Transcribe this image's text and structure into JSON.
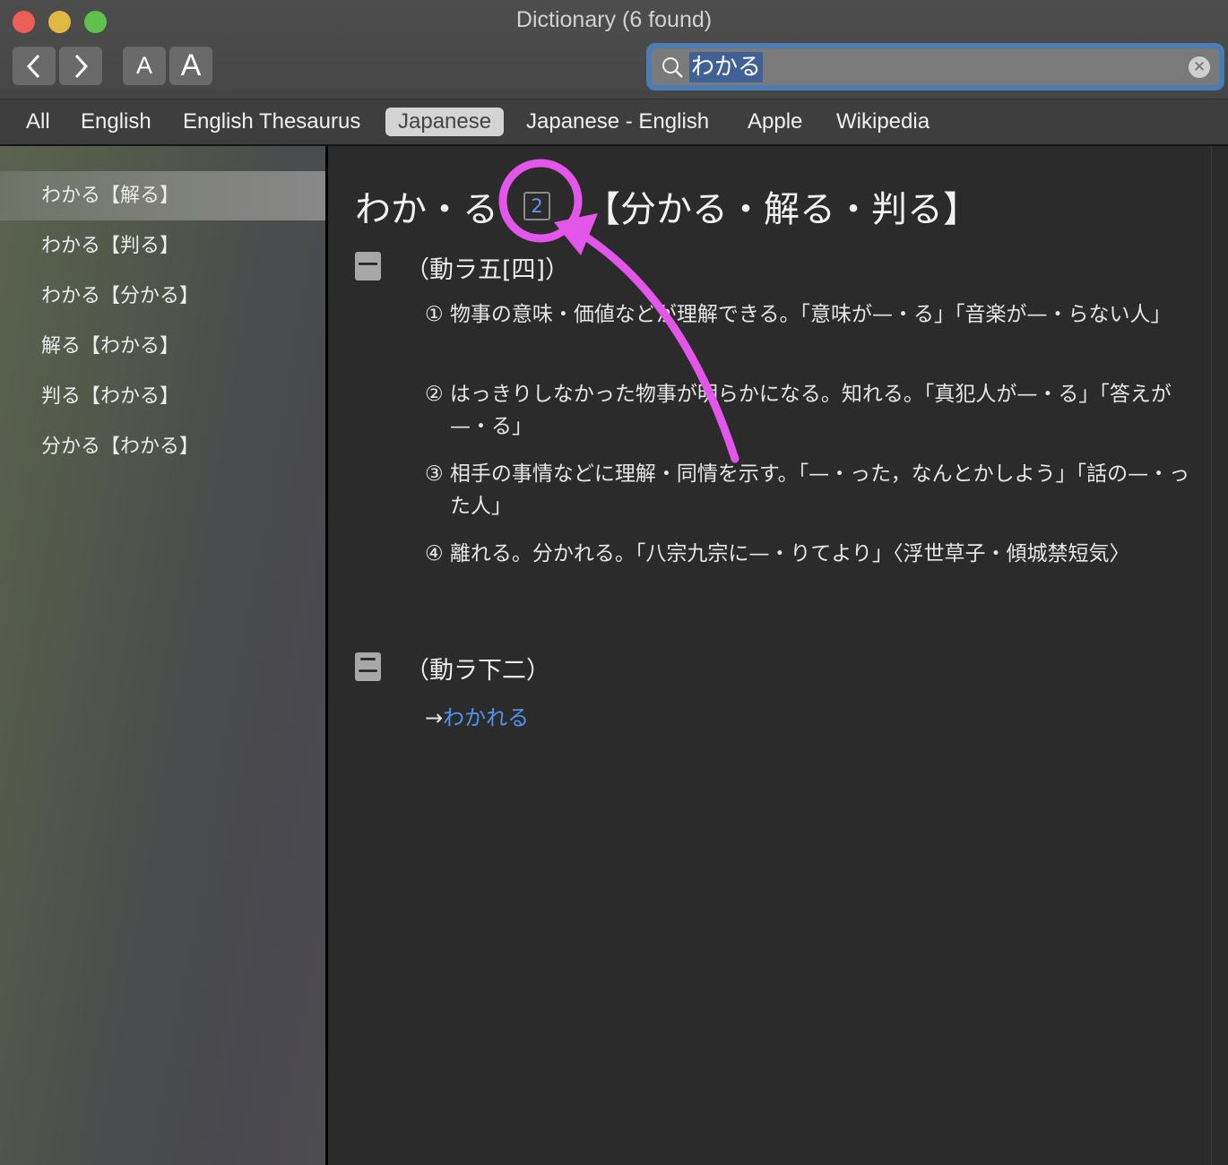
{
  "window": {
    "title": "Dictionary (6 found)"
  },
  "toolbar": {
    "back_icon": "chevron-left-icon",
    "forward_icon": "chevron-right-icon",
    "font_smaller_label": "A",
    "font_bigger_label": "A",
    "search": {
      "value": "わかる",
      "icon": "magnifying-glass-icon",
      "clear_icon": "clear-x-icon"
    }
  },
  "tabs": [
    {
      "label": "All",
      "active": false
    },
    {
      "label": "English",
      "active": false
    },
    {
      "label": "English Thesaurus",
      "active": false
    },
    {
      "label": "Japanese",
      "active": true
    },
    {
      "label": "Japanese - English",
      "active": false
    },
    {
      "label": "Apple",
      "active": false
    },
    {
      "label": "Wikipedia",
      "active": false
    }
  ],
  "sidebar": {
    "items": [
      {
        "label": "わかる【解る】",
        "selected": true
      },
      {
        "label": "わかる【判る】",
        "selected": false
      },
      {
        "label": "わかる【分かる】",
        "selected": false
      },
      {
        "label": "解る【わかる】",
        "selected": false
      },
      {
        "label": "判る【わかる】",
        "selected": false
      },
      {
        "label": "分かる【わかる】",
        "selected": false
      }
    ]
  },
  "entry": {
    "headword": "わか・る",
    "homograph_number": "2",
    "kanji": "【分かる・解る・判る】",
    "senses": [
      {
        "marker": "一",
        "pos": "（動ラ五[四]）",
        "definitions": [
          "① 物事の意味・価値などが理解できる。「意味が—・る」「音楽が—・らない人」",
          "② はっきりしなかった物事が明らかになる。知れる。「真犯人が—・る」「答えが—・る」",
          "③ 相手の事情などに理解・同情を示す。「—・った，なんとかしよう」「話の—・った人」",
          "④ 離れる。分かれる。「八宗九宗に—・りてより」〈浮世草子・傾城禁短気〉"
        ]
      },
      {
        "marker": "二",
        "pos": "（動ラ下二）",
        "xref_arrow": "→",
        "xref_link": "わかれる"
      }
    ]
  },
  "annotation": {
    "color": "#e455ea",
    "shapes": [
      "circle-highlight",
      "curved-arrow"
    ]
  }
}
